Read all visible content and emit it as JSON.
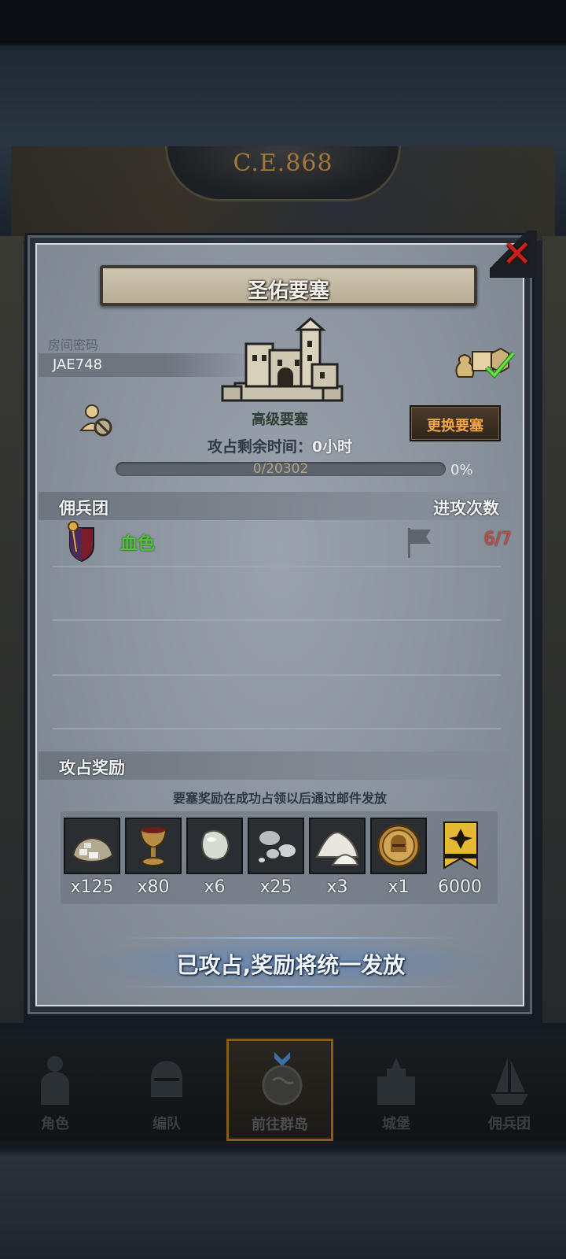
{
  "header": {
    "era": "C.E.868"
  },
  "dialog": {
    "title": "圣佑要塞",
    "room_label": "房间密码",
    "room_code": "JAE748",
    "fortress_type": "高级要塞",
    "remain_label": "攻占剩余时间：",
    "remain_value": "0小时",
    "progress": {
      "text": "0/20302",
      "percent_text": "0%",
      "fraction": 0
    },
    "change_button": "更换要塞",
    "mercenary_section": {
      "left": "佣兵团",
      "right": "进攻次数"
    },
    "mercenaries": [
      {
        "name": "血色",
        "attacks": "6/7"
      }
    ],
    "reward_section": {
      "title": "攻占奖励"
    },
    "reward_note": "要塞奖励在成功占领以后通过邮件发放",
    "rewards": [
      {
        "icon": "stone-pile-icon",
        "qty": "x125"
      },
      {
        "icon": "goblet-icon",
        "qty": "x80"
      },
      {
        "icon": "gem-icon",
        "qty": "x6"
      },
      {
        "icon": "silver-ore-icon",
        "qty": "x25"
      },
      {
        "icon": "salt-pile-icon",
        "qty": "x3"
      },
      {
        "icon": "helmet-coin-icon",
        "qty": "x1"
      },
      {
        "icon": "banner-icon",
        "qty": "6000"
      }
    ],
    "claimed_text": "已攻占,奖励将统一发放"
  },
  "nav": {
    "items": [
      {
        "label": "角色",
        "icon": "knight-icon"
      },
      {
        "label": "编队",
        "icon": "helmet-icon"
      },
      {
        "label": "前往群岛",
        "icon": "globe-icon",
        "active": true
      },
      {
        "label": "城堡",
        "icon": "castle-icon"
      },
      {
        "label": "佣兵团",
        "icon": "ship-icon"
      }
    ]
  },
  "colors": {
    "accent_orange": "#f0a548",
    "merc_green": "#4fc23a",
    "attack_red": "#d14a3c",
    "close_red": "#c7231d"
  }
}
